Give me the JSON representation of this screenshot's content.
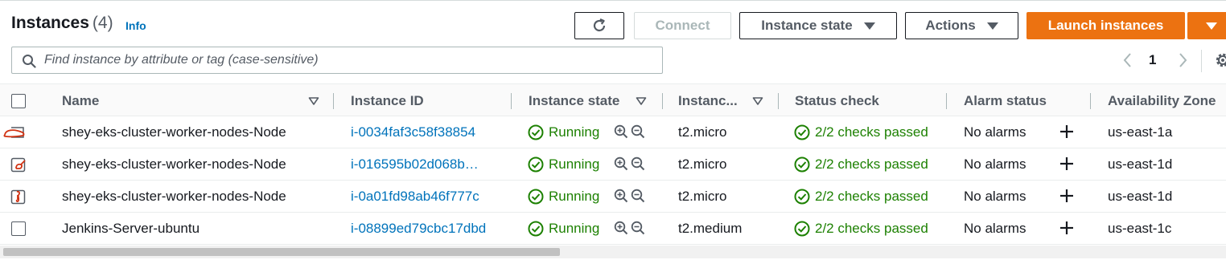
{
  "header": {
    "title": "Instances",
    "count": "(4)",
    "info": "Info"
  },
  "toolbar": {
    "connect_label": "Connect",
    "instance_state_label": "Instance state",
    "actions_label": "Actions",
    "launch_label": "Launch instances"
  },
  "search": {
    "placeholder": "Find instance by attribute or tag (case-sensitive)"
  },
  "pagination": {
    "current_page": "1"
  },
  "table": {
    "columns": [
      "Name",
      "Instance ID",
      "Instance state",
      "Instanc...",
      "Status check",
      "Alarm status",
      "Availability Zone"
    ],
    "rows": [
      {
        "name": "shey-eks-cluster-worker-nodes-Node",
        "instance_id": "i-0034faf3c58f38854",
        "state": "Running",
        "type": "t2.micro",
        "status_check": "2/2 checks passed",
        "alarm": "No alarms",
        "az": "us-east-1a"
      },
      {
        "name": "shey-eks-cluster-worker-nodes-Node",
        "instance_id": "i-016595b02d068b…",
        "state": "Running",
        "type": "t2.micro",
        "status_check": "2/2 checks passed",
        "alarm": "No alarms",
        "az": "us-east-1d"
      },
      {
        "name": "shey-eks-cluster-worker-nodes-Node",
        "instance_id": "i-0a01fd98ab46f777c",
        "state": "Running",
        "type": "t2.micro",
        "status_check": "2/2 checks passed",
        "alarm": "No alarms",
        "az": "us-east-1d"
      },
      {
        "name": "Jenkins-Server-ubuntu",
        "instance_id": "i-08899ed79cbc17dbd",
        "state": "Running",
        "type": "t2.medium",
        "status_check": "2/2 checks passed",
        "alarm": "No alarms",
        "az": "us-east-1c"
      }
    ]
  },
  "colors": {
    "accent": "#ec7211",
    "link": "#0073bb",
    "success": "#1d8102",
    "annotation": "#d13212"
  },
  "icons": [
    "refresh-icon",
    "caret-down-icon",
    "search-icon",
    "chevron-left-icon",
    "chevron-right-icon",
    "settings-gear-icon",
    "sort-icon",
    "check-circle-icon",
    "zoom-in-icon",
    "zoom-out-icon",
    "plus-icon"
  ]
}
